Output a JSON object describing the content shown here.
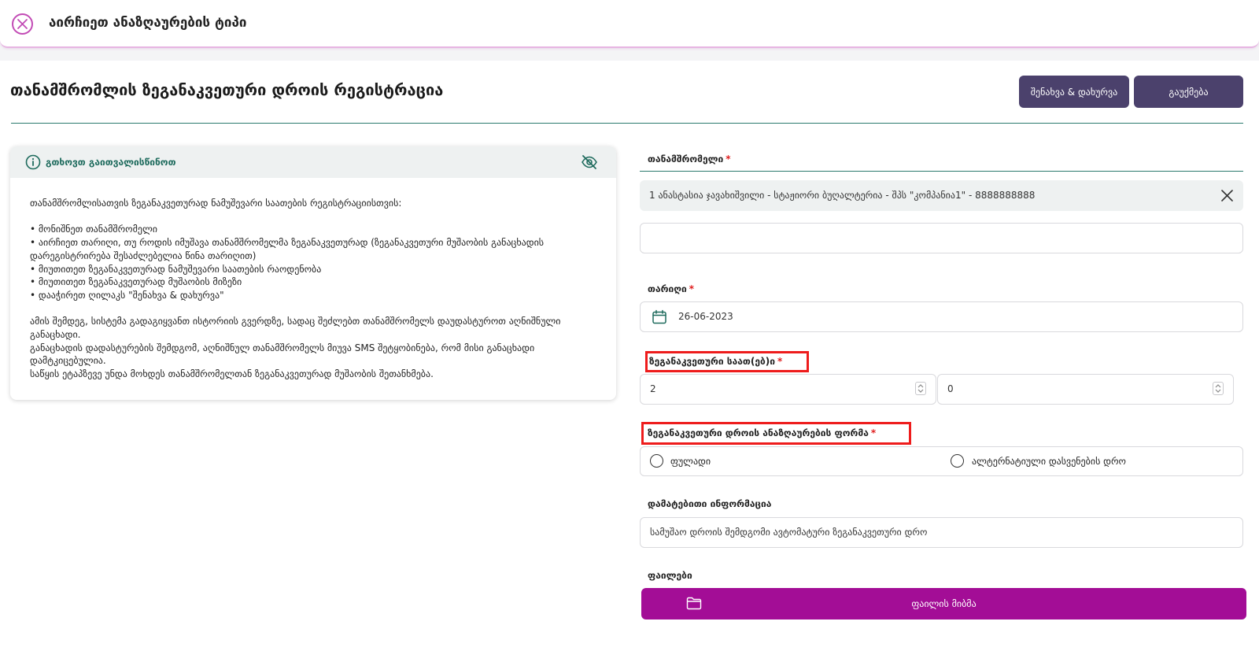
{
  "header": {
    "title": "აირჩიეთ ანაზღაურების ტიპი"
  },
  "form": {
    "title": "თანამშრომლის ზეგანაკვეთური დროის რეგისტრაცია",
    "save_button": "შენახვა & დახურვა",
    "cancel_button": "გაუქმება"
  },
  "info": {
    "title": "გთხოვთ გაითვალისწინოთ",
    "body": "თანამშრომლისათვის ზეგანაკვეთურად ნამუშევარი საათების რეგისტრაციისთვის:\n\n• მონიშნეთ თანამშრომელი\n• აირჩიეთ თარიღი, თუ როდის იმუშავა თანამშრომელმა ზეგანაკვეთურად (ზეგანაკვეთური მუშაობის განაცხადის დარეგისტრირება შესაძლებელია წინა თარიღით)\n• მიუთითეთ ზეგანაკვეთურად ნამუშევარი საათების რაოდენობა\n• მიუთითეთ ზეგანაკვეთურად მუშაობის მიზეზი\n• დააჭირეთ ღილაკს \"შენახვა & დახურვა\"\n\nამის შემდეგ, სისტემა გადაგიყვანთ ისტორიის გვერდზე, სადაც შეძლებთ თანამშრომელს დაუდასტუროთ აღნიშნული განაცხადი.\nგანაცხადის დადასტურების შემდგომ, აღნიშნულ თანამშრომელს მიუვა SMS შეტყობინება, რომ მისი განაცხადი დამტკიცებულია.\nსაწყის ეტაპზევე უნდა მოხდეს თანამშრომელთან ზეგანაკვეთურად მუშაობის შეთანხმება."
  },
  "fields": {
    "employee_label": "თანამშრომელი",
    "employee_value": "1   ანასტასია ჯავახიშვილი - სტაჟიორი ბუღალტერია - შპს \"კომპანია1\" - 8888888888",
    "employee_extra_value": "",
    "date_label": "თარიღი",
    "date_value": "26-06-2023",
    "hours_label": "ზეგანაკვეთური საათ(ებ)ი",
    "hours_value": "2",
    "minutes_value": "0",
    "compensation_label": "ზეგანაკვეთური დროის ანაზღაურების ფორმა",
    "option_cash": "ფულადი",
    "option_timeoff": "ალტერნატიული დასვენების დრო",
    "additional_label": "დამატებითი ინფორმაცია",
    "additional_value": "სამუშაო დროის შემდგომი ავტომატური ზეგანაკვეთური დრო",
    "files_label": "ფაილები",
    "attach_button": "ფაილის მიბმა",
    "required_mark": "*"
  },
  "colors": {
    "primary": "#4b416c",
    "accent": "#a30d96",
    "teal": "#1e6b5d",
    "highlight": "#ee1c1c"
  },
  "icons": {
    "close": "circle-x-icon",
    "info": "info-circle-icon",
    "hide": "eye-slash-icon",
    "calendar": "calendar-icon",
    "folder": "folder-icon"
  }
}
